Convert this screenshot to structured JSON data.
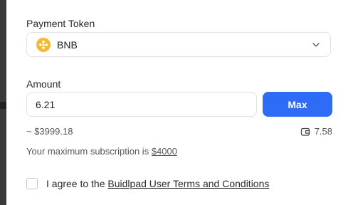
{
  "payment_token": {
    "label": "Payment Token",
    "selected": "BNB",
    "icon": "bnb-icon"
  },
  "amount": {
    "label": "Amount",
    "value": "6.21",
    "max_label": "Max",
    "usd_estimate": "~ $3999.18",
    "wallet_balance": "7.58"
  },
  "subscription": {
    "prefix": "Your maximum subscription is ",
    "max_value": "$4000"
  },
  "terms": {
    "prefix": "I agree to the ",
    "link_text": "Buidlpad User Terms and Conditions"
  },
  "colors": {
    "accent": "#2f6cf5",
    "bnb": "#f3ba2f"
  }
}
